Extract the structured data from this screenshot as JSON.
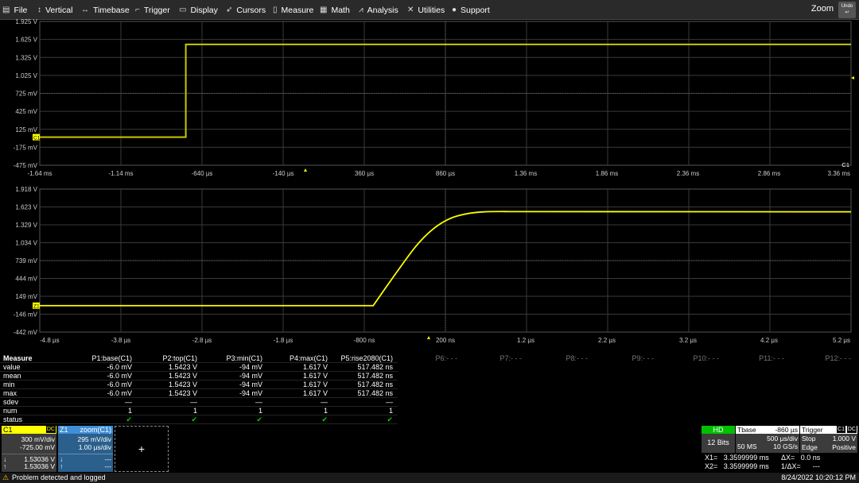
{
  "menu": [
    {
      "label": "File",
      "icon": "file-icon",
      "glyph": "▤"
    },
    {
      "label": "Vertical",
      "icon": "vertical-icon",
      "glyph": "↕"
    },
    {
      "label": "Timebase",
      "icon": "timebase-icon",
      "glyph": "↔"
    },
    {
      "label": "Trigger",
      "icon": "trigger-icon",
      "glyph": "⌐"
    },
    {
      "label": "Display",
      "icon": "display-icon",
      "glyph": "▭"
    },
    {
      "label": "Cursors",
      "icon": "cursors-icon",
      "glyph": "➶"
    },
    {
      "label": "Measure",
      "icon": "measure-icon",
      "glyph": "▯"
    },
    {
      "label": "Math",
      "icon": "math-icon",
      "glyph": "▦"
    },
    {
      "label": "Analysis",
      "icon": "analysis-icon",
      "glyph": "⩘"
    },
    {
      "label": "Utilities",
      "icon": "utilities-icon",
      "glyph": "✕"
    },
    {
      "label": "Support",
      "icon": "support-icon",
      "glyph": "●"
    }
  ],
  "zoom_label": "Zoom",
  "undo_label": "Undo",
  "top_grid": {
    "y_labels": [
      "1.925 V",
      "1.625 V",
      "1.325 V",
      "1.025 V",
      "725 mV",
      "425 mV",
      "125 mV",
      "-175 mV",
      "-475 mV"
    ],
    "x_labels": [
      "-1.64 ms",
      "-1.14 ms",
      "-640 µs",
      "-140 µs",
      "360 µs",
      "860 µs",
      "1.36 ms",
      "1.86 ms",
      "2.36 ms",
      "2.86 ms",
      "3.36 ms"
    ],
    "channel_tag": "C1",
    "marker": "C1"
  },
  "bottom_grid": {
    "y_labels": [
      "1.918 V",
      "1.623 V",
      "1.329 V",
      "1.034 V",
      "739 mV",
      "444 mV",
      "149 mV",
      "-146 mV",
      "-442 mV"
    ],
    "x_labels": [
      "-4.8 µs",
      "-3.8 µs",
      "-2.8 µs",
      "-1.8 µs",
      "-800 ns",
      "200 ns",
      "1.2 µs",
      "2.2 µs",
      "3.2 µs",
      "4.2 µs",
      "5.2 µs"
    ],
    "marker": "Z1"
  },
  "chart_data": {
    "type": "line",
    "title": "",
    "series": [
      {
        "name": "C1",
        "x_ms": [
          -1.64,
          -0.74,
          -0.74,
          3.36
        ],
        "y_V": [
          -0.006,
          -0.006,
          1.5423,
          1.5423
        ]
      }
    ],
    "zoom_series": [
      {
        "name": "Z1",
        "x_us": [
          -4.8,
          -0.69,
          -0.4,
          -0.1,
          0.2,
          0.5,
          0.8,
          1.2,
          5.2
        ],
        "y_V": [
          -0.006,
          -0.006,
          0.55,
          1.1,
          1.42,
          1.53,
          1.55,
          1.5423,
          1.5423
        ]
      }
    ],
    "top_ylim": [
      -0.475,
      1.925
    ],
    "top_xlim_ms": [
      -1.64,
      3.36
    ],
    "bottom_ylim": [
      -0.442,
      1.918
    ],
    "bottom_xlim_us": [
      -4.8,
      5.2
    ]
  },
  "measure": {
    "header": "Measure",
    "row_labels": [
      "value",
      "mean",
      "min",
      "max",
      "sdev",
      "num",
      "status"
    ],
    "params": [
      {
        "name": "P1:base(C1)",
        "values": [
          "-6.0 mV",
          "-6.0 mV",
          "-6.0 mV",
          "-6.0 mV",
          "—",
          "1",
          "✔"
        ]
      },
      {
        "name": "P2:top(C1)",
        "values": [
          "1.5423 V",
          "1.5423 V",
          "1.5423 V",
          "1.5423 V",
          "—",
          "1",
          "✔"
        ]
      },
      {
        "name": "P3:min(C1)",
        "values": [
          "-94 mV",
          "-94 mV",
          "-94 mV",
          "-94 mV",
          "—",
          "1",
          "✔"
        ]
      },
      {
        "name": "P4:max(C1)",
        "values": [
          "1.617 V",
          "1.617 V",
          "1.617 V",
          "1.617 V",
          "—",
          "1",
          "✔"
        ]
      },
      {
        "name": "P5:rise2080(C1)",
        "values": [
          "517.482 ns",
          "517.482 ns",
          "517.482 ns",
          "517.482 ns",
          "—",
          "1",
          "✔"
        ]
      }
    ],
    "off_params": [
      "P6:- - -",
      "P7:- - -",
      "P8:- - -",
      "P9:- - -",
      "P10:- - -",
      "P11:- - -",
      "P12:- - -"
    ]
  },
  "c1_badge": {
    "title": "C1",
    "coupling": "DC",
    "vdiv": "300 mV/div",
    "offset": "-725.00 mV",
    "cur1": "1.53036 V",
    "cur2": "1.53036 V"
  },
  "z1_badge": {
    "title": "Z1",
    "label": "zoom(C1)",
    "vdiv": "295 mV/div",
    "tdiv": "1.00 µs/div",
    "cur1": "---",
    "cur2": "---"
  },
  "add_label": "+",
  "hd": {
    "label": "HD",
    "bits": "12 Bits"
  },
  "tbase": {
    "label": "Tbase",
    "delay": "-860 µs",
    "tdiv": "500 µs/div",
    "samples": "50 MS",
    "rate": "10 GS/s"
  },
  "trigger": {
    "label": "Trigger",
    "src": "C1",
    "coupling": "DC",
    "mode": "Stop",
    "level": "1.000 V",
    "type": "Edge",
    "slope": "Positive"
  },
  "cursor_read": {
    "x1": "X1=   3.3599999 ms",
    "dx": "ΔX=   0.0 ns",
    "x2": "X2=   3.3599999 ms",
    "idx": "1/ΔX=      ---"
  },
  "status": {
    "message": "Problem detected and logged",
    "datetime": "8/24/2022 10:20:12 PM"
  },
  "colors": {
    "trace": "#ffff00",
    "trace_top": "#c8c800",
    "c1": "#ffff00",
    "z1": "#3f8fd6",
    "hd": "#00c000",
    "grid": "#3a3a3a"
  }
}
